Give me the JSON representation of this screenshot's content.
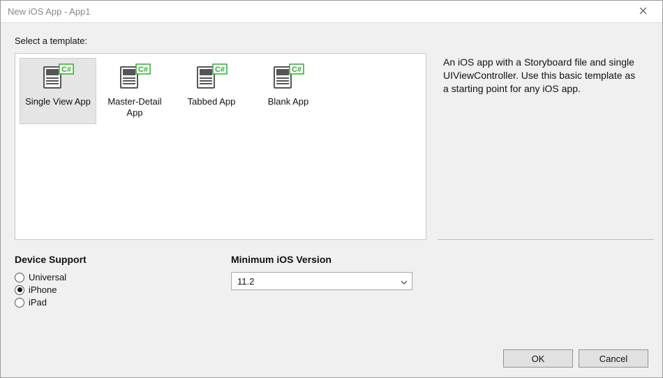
{
  "window": {
    "title": "New iOS App - App1"
  },
  "prompt": "Select a template:",
  "templates": [
    {
      "label": "Single View App",
      "selected": true
    },
    {
      "label": "Master-Detail App",
      "selected": false
    },
    {
      "label": "Tabbed App",
      "selected": false
    },
    {
      "label": "Blank App",
      "selected": false
    }
  ],
  "description": "An iOS app with a Storyboard file and single UIViewController. Use this basic template as a starting point for any iOS app.",
  "device_support": {
    "title": "Device Support",
    "options": [
      {
        "label": "Universal",
        "checked": false
      },
      {
        "label": "iPhone",
        "checked": true
      },
      {
        "label": "iPad",
        "checked": false
      }
    ]
  },
  "min_ios": {
    "title": "Minimum iOS Version",
    "value": "11.2"
  },
  "buttons": {
    "ok": "OK",
    "cancel": "Cancel"
  }
}
